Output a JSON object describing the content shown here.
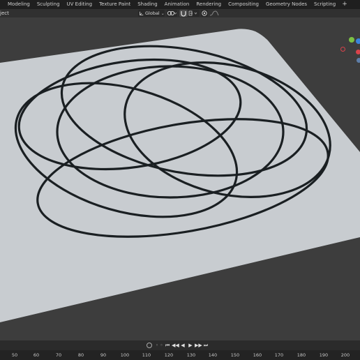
{
  "workspace_tabs": [
    "Modeling",
    "Sculpting",
    "UV Editing",
    "Texture Paint",
    "Shading",
    "Animation",
    "Rendering",
    "Compositing",
    "Geometry Nodes",
    "Scripting"
  ],
  "add_workspace_label": "+",
  "header": {
    "mode_label": "ject",
    "orientation_label": "Global"
  },
  "icons": {
    "orientation": "axes-icon",
    "pivot": "link-icon",
    "snap": "magnet-icon",
    "proportional": "circle-dot-icon",
    "falloff": "curve-icon"
  },
  "colors": {
    "viewport_bg": "#3d3d3d",
    "plane": "#c8ccd0",
    "rings": "#1a1f22",
    "gizmo_x": "#d9434b",
    "gizmo_y": "#7cc144",
    "gizmo_z": "#3a84dc"
  },
  "timeline": {
    "ellipsis": "◦ ◦",
    "frame_labels": [
      "50",
      "60",
      "70",
      "80",
      "90",
      "100",
      "110",
      "120",
      "130",
      "140",
      "150",
      "160",
      "170",
      "180",
      "190",
      "200"
    ]
  }
}
